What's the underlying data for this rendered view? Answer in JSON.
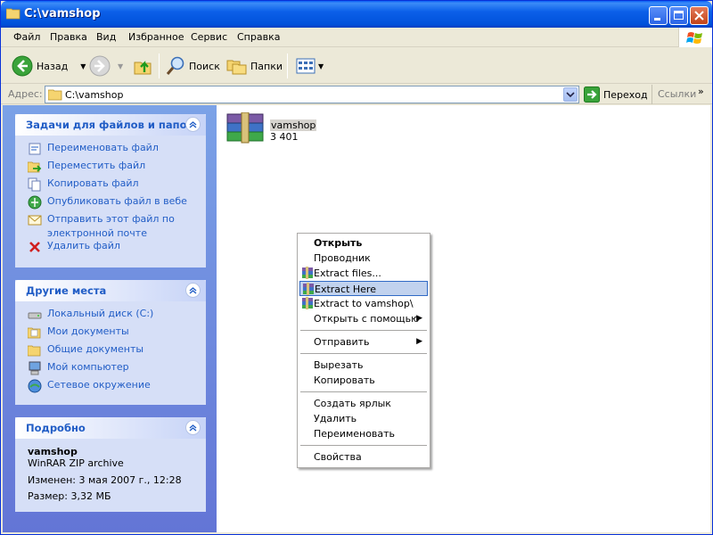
{
  "window": {
    "title": "C:\\vamshop"
  },
  "menubar": {
    "items": [
      "Файл",
      "Правка",
      "Вид",
      "Избранное",
      "Сервис",
      "Справка"
    ]
  },
  "toolbar": {
    "back": "Назад",
    "search": "Поиск",
    "folders": "Папки"
  },
  "addressbar": {
    "label": "Адрес:",
    "value": "C:\\vamshop",
    "go": "Переход",
    "links": "Ссылки"
  },
  "taskpane": {
    "file_tasks": {
      "title": "Задачи для файлов и папок",
      "items": [
        "Переименовать файл",
        "Переместить файл",
        "Копировать файл",
        "Опубликовать файл в вебе",
        "Отправить этот файл по электронной почте",
        "Удалить файл"
      ]
    },
    "other_places": {
      "title": "Другие места",
      "items": [
        "Локальный диск (C:)",
        "Мои документы",
        "Общие документы",
        "Мой компьютер",
        "Сетевое окружение"
      ]
    },
    "details": {
      "title": "Подробно",
      "name": "vamshop",
      "type": "WinRAR ZIP archive",
      "modified": "Изменен: 3 мая 2007 г., 12:28",
      "size": "Размер: 3,32 МБ"
    }
  },
  "file": {
    "name": "vamshop",
    "size": "3 401"
  },
  "context_menu": {
    "items": [
      {
        "label": "Открыть",
        "bold": true
      },
      {
        "label": "Проводник"
      },
      {
        "label": "Extract files...",
        "icon": "winrar-icon"
      },
      {
        "label": "Extract Here",
        "icon": "winrar-icon",
        "highlighted": true
      },
      {
        "label": "Extract to vamshop\\",
        "icon": "winrar-icon"
      },
      {
        "label": "Открыть с помощью",
        "submenu": true
      },
      {
        "label": "Отправить",
        "submenu": true
      },
      {
        "label": "Вырезать"
      },
      {
        "label": "Копировать"
      },
      {
        "label": "Создать ярлык"
      },
      {
        "label": "Удалить"
      },
      {
        "label": "Переименовать"
      },
      {
        "label": "Свойства"
      }
    ]
  },
  "colors": {
    "titlebar": "#0054e3",
    "taskpane_link": "#215dc6",
    "taskpane_bg": "#6f8fdf",
    "panel_bg": "#d6dff7",
    "menu_highlight": "#c1d2ee"
  }
}
